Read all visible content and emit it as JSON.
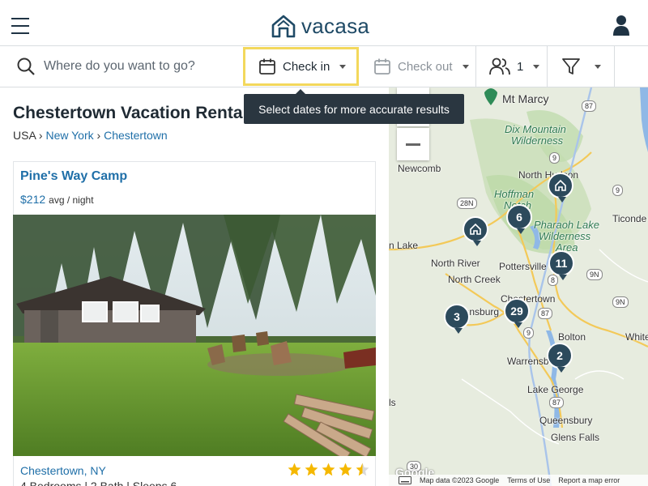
{
  "header": {
    "logo_text": "vacasa",
    "menu_icon": "hamburger-menu-icon",
    "user_icon": "user-icon"
  },
  "search": {
    "placeholder": "Where do you want to go?",
    "check_in_label": "Check in",
    "check_out_label": "Check out",
    "guests_count": "1"
  },
  "tooltip": {
    "text": "Select dates for more accurate results"
  },
  "listing_page": {
    "title": "Chestertown Vacation Renta",
    "breadcrumb": {
      "country": "USA",
      "sep": "›",
      "state": "New York",
      "city": "Chestertown"
    }
  },
  "card": {
    "title": "Pine's Way Camp",
    "price": "$212",
    "price_unit": "avg / night",
    "location": "Chestertown, NY",
    "rating": 4.5,
    "details": "4 Bedrooms | 2 Bath | Sleeps 6"
  },
  "map": {
    "labels": {
      "mt_marcy": "Mt Marcy",
      "dix1": "Dix Mountain",
      "dix2": "Wilderness",
      "newcomb": "Newcomb",
      "north_hudson": "North Hudson",
      "hoffman1": "Hoffman",
      "hoffman2": "Notch",
      "pharaoh1": "Pharaoh Lake",
      "pharaoh2": "Wilderness",
      "pharaoh3": "Area",
      "ticonderoga": "Ticonde",
      "lake": "n Lake",
      "north_river": "North River",
      "pottersville": "Pottersville",
      "north_creek": "North Creek",
      "chestertown": "Chestertown",
      "johnsburg": "Johnsburg",
      "bolton": "Bolton",
      "white": "White",
      "warrensburg": "Warrensb",
      "lake_george": "Lake George",
      "ls": "ls",
      "queensbury": "Queensbury",
      "glens_falls": "Glens Falls"
    },
    "shields": {
      "r87a": "87",
      "r9a": "9",
      "r28n": "28N",
      "r9b": "9",
      "r8": "8",
      "r9n": "9N",
      "r9n2": "9N",
      "r87b": "87",
      "r9c": "9",
      "r87c": "87",
      "r30": "30"
    },
    "clusters": {
      "c6": "6",
      "c11": "11",
      "c29": "29",
      "c3": "3",
      "c2": "2"
    },
    "attribution": {
      "google": "Google",
      "data": "Map data ©2023 Google",
      "terms": "Terms of Use",
      "report": "Report a map error"
    }
  },
  "colors": {
    "accent_blue": "#1f6fa8",
    "brand_navy": "#1f4a66",
    "highlight_yellow": "#f3d85c",
    "tooltip_bg": "#2a3640",
    "star": "#f5b800"
  }
}
